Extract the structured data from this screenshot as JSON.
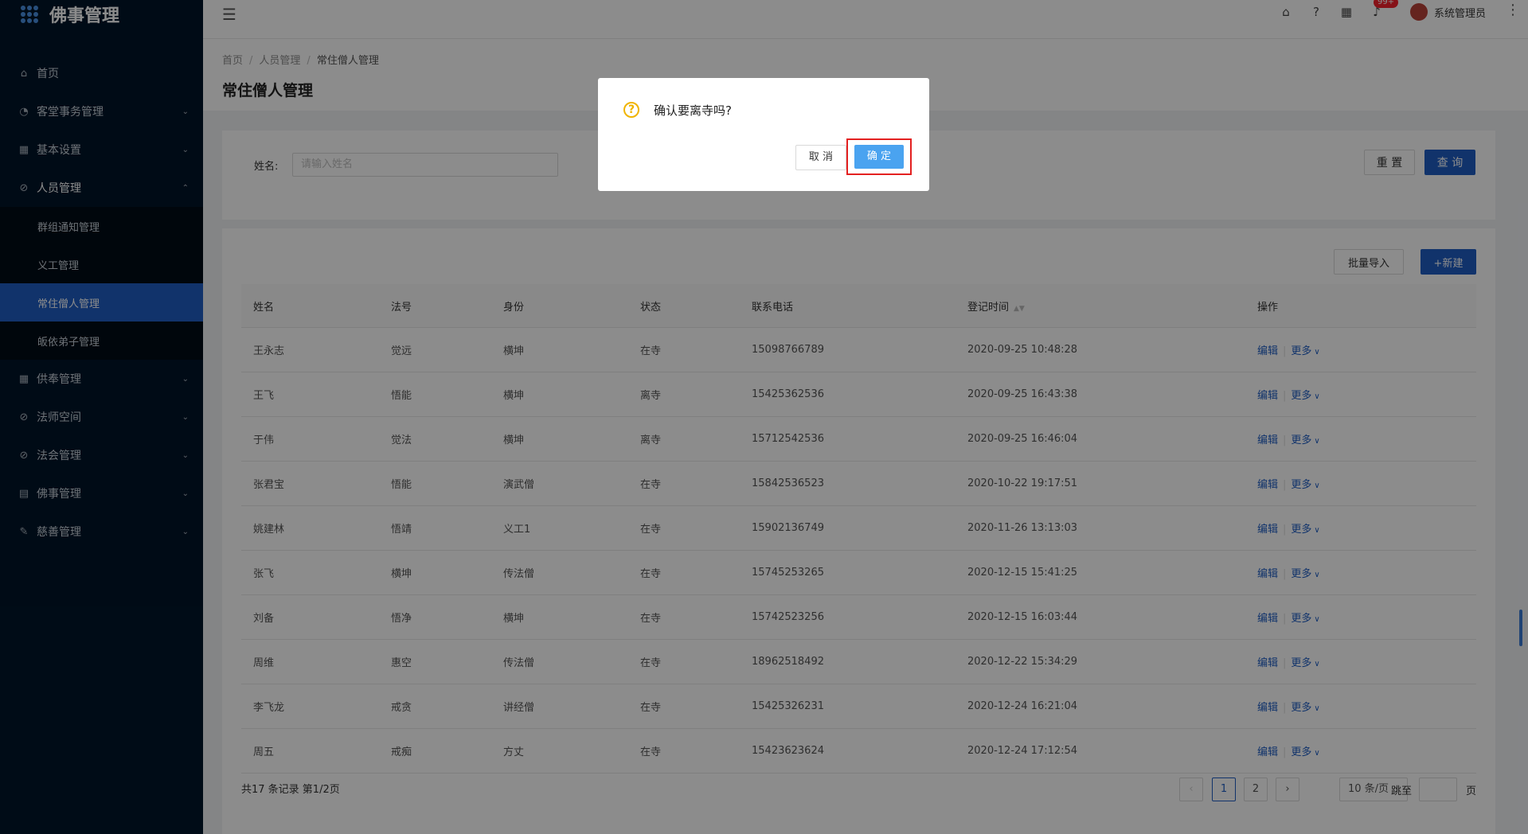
{
  "app": {
    "title": "佛事管理"
  },
  "sidebar": {
    "items": [
      {
        "label": "首页",
        "icon": "home-icon",
        "arrow": ""
      },
      {
        "label": "客堂事务管理",
        "icon": "dashboard-icon",
        "arrow": "⌄"
      },
      {
        "label": "基本设置",
        "icon": "table-icon",
        "arrow": "⌄"
      },
      {
        "label": "人员管理",
        "icon": "check-circle-icon",
        "arrow": "⌃"
      }
    ],
    "submenu": [
      {
        "label": "群组通知管理"
      },
      {
        "label": "义工管理"
      },
      {
        "label": "常住僧人管理"
      },
      {
        "label": "皈依弟子管理"
      }
    ],
    "items_after": [
      {
        "label": "供奉管理",
        "icon": "table-icon",
        "arrow": "⌄"
      },
      {
        "label": "法师空间",
        "icon": "check-circle-icon",
        "arrow": "⌄"
      },
      {
        "label": "法会管理",
        "icon": "check-circle-icon",
        "arrow": "⌄"
      },
      {
        "label": "佛事管理",
        "icon": "list-icon",
        "arrow": "⌄"
      },
      {
        "label": "慈善管理",
        "icon": "edit-icon",
        "arrow": "⌄"
      }
    ]
  },
  "topbar": {
    "badge": "99+",
    "username": "系统管理员"
  },
  "breadcrumb": {
    "items": [
      "首页",
      "人员管理",
      "常住僧人管理"
    ]
  },
  "page": {
    "title": "常住僧人管理"
  },
  "search": {
    "name_label": "姓名:",
    "name_placeholder": "请输入姓名",
    "reset": "重 置",
    "query": "查 询"
  },
  "table": {
    "import": "批量导入",
    "create": "+新建",
    "columns": [
      "姓名",
      "法号",
      "身份",
      "状态",
      "联系电话",
      "登记时间",
      "操作"
    ],
    "action_edit": "编辑",
    "action_more": "更多",
    "rows": [
      [
        "王永志",
        "觉远",
        "横坤",
        "在寺",
        "15098766789",
        "2020-09-25 10:48:28"
      ],
      [
        "王飞",
        "悟能",
        "横坤",
        "离寺",
        "15425362536",
        "2020-09-25 16:43:38"
      ],
      [
        "于伟",
        "觉法",
        "横坤",
        "离寺",
        "15712542536",
        "2020-09-25 16:46:04"
      ],
      [
        "张君宝",
        "悟能",
        "演武僧",
        "在寺",
        "15842536523",
        "2020-10-22 19:17:51"
      ],
      [
        "姚建林",
        "悟靖",
        "义工1",
        "在寺",
        "15902136749",
        "2020-11-26 13:13:03"
      ],
      [
        "张飞",
        "横坤",
        "传法僧",
        "在寺",
        "15745253265",
        "2020-12-15 15:41:25"
      ],
      [
        "刘备",
        "悟净",
        "横坤",
        "在寺",
        "15742523256",
        "2020-12-15 16:03:44"
      ],
      [
        "周维",
        "惠空",
        "传法僧",
        "在寺",
        "18962518492",
        "2020-12-22 15:34:29"
      ],
      [
        "李飞龙",
        "戒贪",
        "讲经僧",
        "在寺",
        "15425326231",
        "2020-12-24 16:21:04"
      ],
      [
        "周五",
        "戒痴",
        "方丈",
        "在寺",
        "15423623624",
        "2020-12-24 17:12:54"
      ]
    ]
  },
  "pagination": {
    "summary": "共17 条记录 第1/2页",
    "pages": [
      "1",
      "2"
    ],
    "page_size": "10 条/页",
    "jump_label": "跳至",
    "page_unit": "页"
  },
  "modal": {
    "message": "确认要离寺吗?",
    "cancel": "取 消",
    "ok": "确 定"
  }
}
